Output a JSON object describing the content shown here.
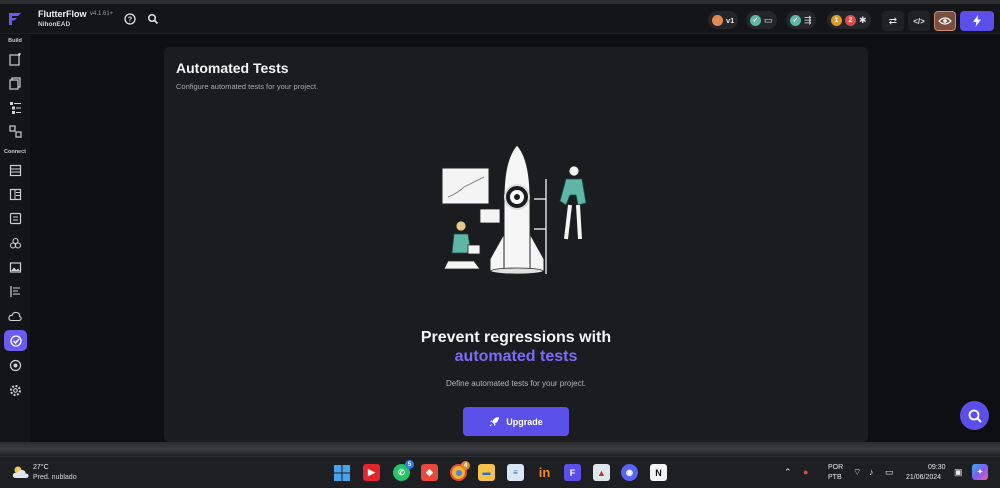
{
  "app": {
    "name": "FlutterFlow",
    "version": "v4.1.61+",
    "project": "NihonEAD"
  },
  "topbar": {
    "version_badge": "v1",
    "badge_orange_count": "1",
    "badge_red_count": "2"
  },
  "sidebar": {
    "section_build": "Build",
    "section_connect": "Connect"
  },
  "panel": {
    "title": "Automated Tests",
    "subtitle": "Configure automated tests for your project.",
    "headline_line1": "Prevent regressions with",
    "headline_line2": "automated tests",
    "description": "Define automated tests for your project.",
    "upgrade_label": "Upgrade"
  },
  "taskbar": {
    "temperature": "27°C",
    "weather": "Pred. nublado",
    "whatsapp_badge": "5",
    "chrome_badge": "4",
    "language_line1": "POR",
    "language_line2": "PTB",
    "time": "09:30",
    "date": "21/06/2024"
  },
  "colors": {
    "accent": "#5b4fe9",
    "accent_text": "#7b6cf6",
    "background": "#0e0f11",
    "panel": "#1b1c20"
  },
  "icons": [
    "flutterflow-logo-icon",
    "help-icon",
    "search-icon",
    "share-icon",
    "code-icon",
    "preview-eye-icon",
    "lightning-icon",
    "chat-search-icon"
  ]
}
